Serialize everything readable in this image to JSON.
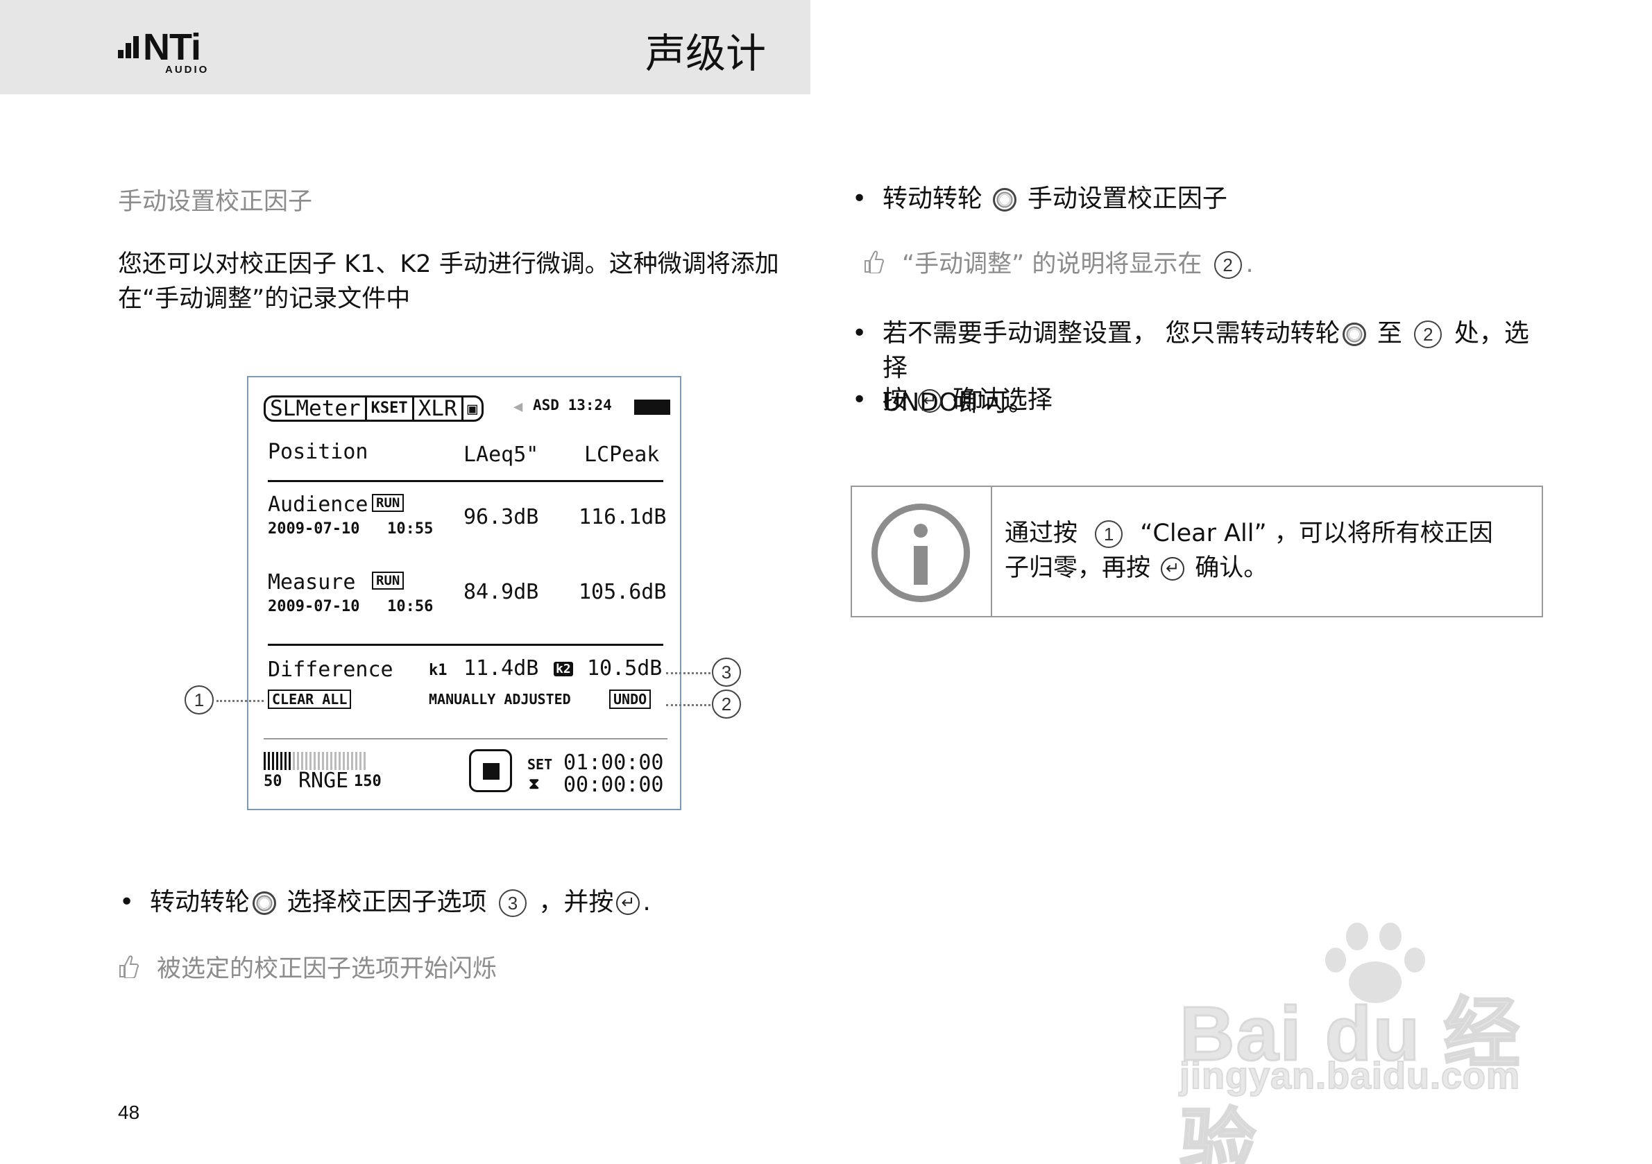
{
  "header": {
    "brand": "NTi",
    "brand_sub": "AUDIO",
    "title": "声级计"
  },
  "left": {
    "section_title": "手动设置校正因子",
    "intro": "您还可以对校正因子 K1、K2 手动进行微调。这种微调将添加在“手动调整”的记录文件中",
    "bullet1_a": "转动转轮",
    "bullet1_b": "选择校正因子选项",
    "bullet1_num": "3",
    "bullet1_c": "，并按",
    "bullet1_end": ".",
    "tip1": "被选定的校正因子选项开始闪烁"
  },
  "device": {
    "tabs": [
      "SLMeter",
      "KSET",
      "XLR",
      "▣"
    ],
    "status": "ASD 13:24",
    "col_position": "Position",
    "col_laeq": "LAeq5\"",
    "col_lcpeak": "LCPeak",
    "rows": [
      {
        "name": "Audience",
        "badge": "RUN",
        "datetime": "2009-07-10   10:55",
        "laeq": "96.3dB",
        "lcpeak": "116.1dB"
      },
      {
        "name": "Measure",
        "badge": "RUN",
        "datetime": "2009-07-10   10:56",
        "laeq": "84.9dB",
        "lcpeak": "105.6dB"
      }
    ],
    "difference_label": "Difference",
    "k1_label": "k1",
    "k1_value": "11.4dB",
    "k2_label": "k2",
    "k2_value": "10.5dB",
    "clear_all": "CLEAR ALL",
    "manually_adjusted": "MANUALLY ADJUSTED",
    "undo": "UNDO",
    "range_low": "50",
    "range_label": "RNGE",
    "range_high": "150",
    "set_label": "SET",
    "set_time": "01:00:00",
    "elapsed_time": "00:00:00",
    "callouts": [
      "1",
      "2",
      "3"
    ]
  },
  "right": {
    "bullet1_a": "转动转轮",
    "bullet1_b": "手动设置校正因子",
    "tip1_a": "“手动调整” 的说明将显示在",
    "tip1_num": "2",
    "tip1_end": ".",
    "bullet2_a": "若不需要手动调整设置， 您只需转动转轮",
    "bullet2_b": "至",
    "bullet2_num": "2",
    "bullet2_c": "处，选择",
    "bullet2_d": "UNDO即可。",
    "bullet3_a": "按",
    "bullet3_b": "确认选择"
  },
  "info": {
    "text_a": "通过按",
    "num": "1",
    "text_b": "“Clear All” ，可以将所有校正因",
    "text_c": "子归零，再按",
    "text_d": "确认。"
  },
  "page_number": "48",
  "watermark": {
    "brand": "Bai du 经验",
    "url": "jingyan.baidu.com"
  }
}
